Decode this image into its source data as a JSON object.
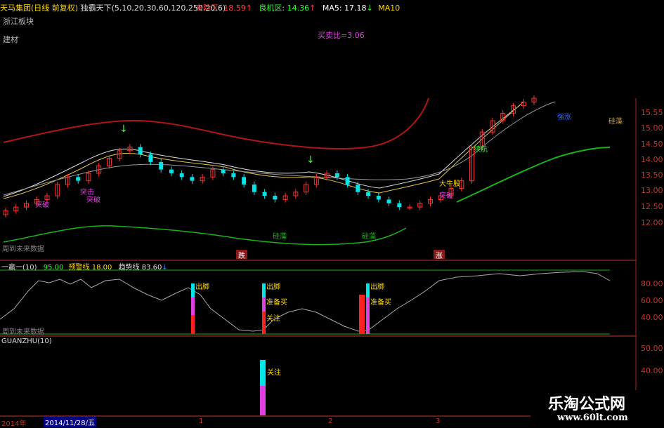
{
  "header": {
    "stock_name": "天马集团",
    "period": "(日线 前复权)",
    "indicator": "独霸天下(5,10,20,30,60,120,250,20,6)",
    "zone1_label": "高险区",
    "zone1_value": "18.59",
    "zone2_label": "良机区",
    "zone2_value": "14.36",
    "ma5": "MA5: 17.18",
    "ma10": "MA10"
  },
  "sector1": "浙江板块",
  "sector2": "建材",
  "buy_sell_ratio": "买卖比=3.06",
  "upper_labels": {
    "tupo1": "突破",
    "tuji": "突击",
    "tupo2": "突破",
    "qiangzhang": "强涨",
    "xuhang": "续航",
    "tupo3": "突破",
    "niuguzhang": "大牛股",
    "dijian1": "硅藻",
    "dijian2": "硅藻",
    "right_label": "硅藻",
    "future_note": "周到未来数据",
    "marker1": "跌",
    "marker2": "涨"
  },
  "mid_header": {
    "name": "一赢一(10)",
    "v1": "95.00",
    "v2_label": "预警线",
    "v2": "18.00",
    "v3_label": "趋势线",
    "v3": "83.60"
  },
  "mid_labels": {
    "chuchao1": "出脚",
    "chuchao2": "出脚",
    "chuchao3": "出脚",
    "zhunbei1": "准备买",
    "zhunbei2": "准备买",
    "guanzhu": "关注",
    "future_note": "周到未来数据"
  },
  "low_header": {
    "name": "GUANZHU(10)"
  },
  "low_labels": {
    "guanzhu": "关注"
  },
  "date_bar": {
    "year": "2014年",
    "date": "2014/11/28/五",
    "t1": "1",
    "t2": "2",
    "t3": "3"
  },
  "watermark": {
    "name": "乐淘公式网",
    "url": "www.60lt.com"
  },
  "chart_data": [
    {
      "type": "line",
      "name": "price",
      "y_ticks": [
        "15.55",
        "15.00",
        "14.50",
        "14.00",
        "13.50",
        "13.00",
        "12.50",
        "12.00"
      ],
      "ylim": [
        11.6,
        15.9
      ],
      "closes": [
        12.9,
        13.0,
        13.1,
        13.2,
        13.3,
        13.6,
        13.8,
        13.7,
        13.9,
        14.1,
        14.3,
        14.5,
        14.6,
        14.4,
        14.2,
        14.0,
        13.9,
        13.8,
        13.7,
        13.8,
        14.0,
        13.9,
        13.8,
        13.6,
        13.4,
        13.3,
        13.2,
        13.3,
        13.4,
        13.6,
        13.8,
        13.9,
        13.8,
        13.6,
        13.4,
        13.3,
        13.2,
        13.1,
        13.0,
        13.0,
        13.1,
        13.2,
        13.3,
        13.5,
        13.7,
        14.6,
        15.0,
        15.3,
        15.5,
        15.7,
        15.8,
        15.9
      ]
    },
    {
      "type": "line",
      "name": "一赢一",
      "y_ticks": [
        "80.00",
        "60.00",
        "40.00"
      ],
      "ylim": [
        18,
        95
      ]
    },
    {
      "type": "bar",
      "name": "GUANZHU",
      "y_ticks": [
        "50.00",
        "40.00"
      ],
      "ylim": [
        0,
        55
      ]
    }
  ],
  "colors": {
    "up": "#ff3030",
    "down": "#00e5e5",
    "grid_red": "#c0392b",
    "magenta": "#e040e0",
    "yellow": "#ffd700",
    "green": "#19b219"
  }
}
